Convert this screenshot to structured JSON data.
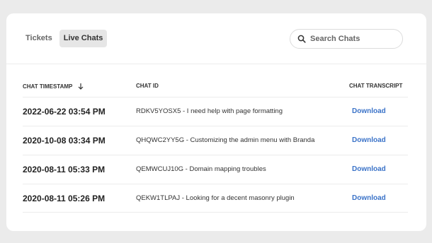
{
  "tabs": [
    {
      "label": "Tickets",
      "active": false
    },
    {
      "label": "Live Chats",
      "active": true
    }
  ],
  "search": {
    "placeholder": "Search Chats",
    "icon": "search-icon"
  },
  "table": {
    "headers": {
      "timestamp": "CHAT TIMESTAMP",
      "chat_id": "CHAT ID",
      "transcript": "CHAT TRANSCRIPT"
    },
    "sort_icon": "arrow-down-icon",
    "rows": [
      {
        "timestamp": "2022-06-22 03:54 PM",
        "chat": "RDKV5YOSX5 - I need help with page formatting",
        "action": "Download"
      },
      {
        "timestamp": "2020-10-08 03:34 PM",
        "chat": "QHQWC2YY5G - Customizing the admin menu with Branda",
        "action": "Download"
      },
      {
        "timestamp": "2020-08-11 05:33 PM",
        "chat": "QEMWCUJ10G - Domain mapping troubles",
        "action": "Download"
      },
      {
        "timestamp": "2020-08-11 05:26 PM",
        "chat": "QEKW1TLPAJ - Looking for a decent masonry plugin",
        "action": "Download"
      }
    ]
  },
  "colors": {
    "link": "#3b73c8",
    "page_background": "#ebebeb",
    "card_background": "#ffffff",
    "active_tab": "#e6e6e6"
  }
}
